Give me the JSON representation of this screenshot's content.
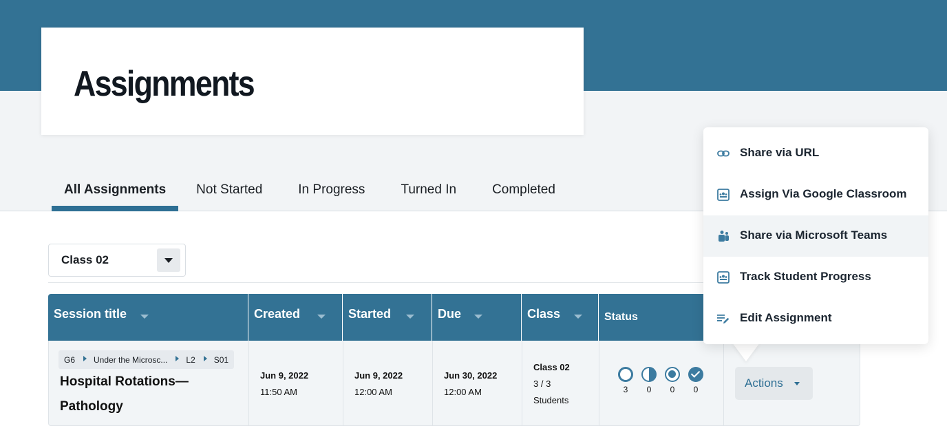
{
  "page": {
    "title": "Assignments"
  },
  "tabs": [
    {
      "label": "All Assignments",
      "active": true
    },
    {
      "label": "Not Started",
      "active": false
    },
    {
      "label": "In Progress",
      "active": false
    },
    {
      "label": "Turned In",
      "active": false
    },
    {
      "label": "Completed",
      "active": false
    }
  ],
  "class_filter": {
    "selected": "Class 02"
  },
  "table": {
    "columns": [
      "Session title",
      "Created",
      "Started",
      "Due",
      "Class",
      "Status"
    ],
    "rows": [
      {
        "breadcrumb": [
          "G6",
          "Under the Microsc...",
          "L2",
          "S01"
        ],
        "title": "Hospital Rotations—Pathology",
        "created_date": "Jun 9, 2022",
        "created_time": "11:50 AM",
        "started_date": "Jun 9, 2022",
        "started_time": "12:00 AM",
        "due_date": "Jun 30, 2022",
        "due_time": "12:00 AM",
        "class_name": "Class 02",
        "class_count": "3 / 3",
        "class_students": "Students",
        "status": {
          "not_started": "3",
          "in_progress": "0",
          "turned_in": "0",
          "completed": "0"
        },
        "actions_label": "Actions"
      }
    ]
  },
  "actions_menu": {
    "items": [
      {
        "label": "Share via URL",
        "icon": "link-icon"
      },
      {
        "label": "Assign Via Google Classroom",
        "icon": "google-classroom-icon"
      },
      {
        "label": "Share via Microsoft Teams",
        "icon": "microsoft-teams-icon"
      },
      {
        "label": "Track Student Progress",
        "icon": "classroom-board-icon"
      },
      {
        "label": "Edit Assignment",
        "icon": "edit-list-icon"
      }
    ]
  },
  "colors": {
    "brand": "#337294",
    "accent": "#2e6f94",
    "row_bg": "#f2f5f7"
  }
}
